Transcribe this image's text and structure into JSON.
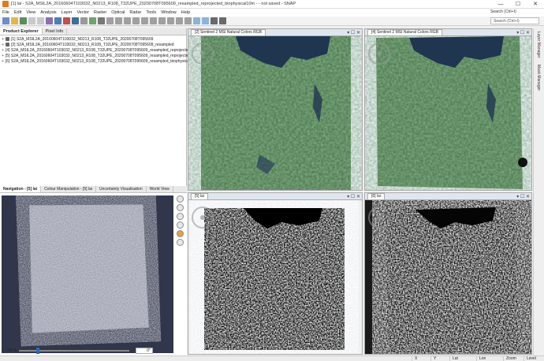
{
  "window": {
    "title": "[1] lai - S2A_MSIL2A_20160604T103032_N0213_R108_T32UPE_20200708T095609_resampled_reprojected_biophysical10m - - not saved - SNAP",
    "controls": {
      "minimize": "—",
      "maximize": "☐",
      "close": "✕"
    }
  },
  "menu": [
    "File",
    "Edit",
    "View",
    "Analysis",
    "Layer",
    "Vector",
    "Raster",
    "Optical",
    "Radar",
    "Tools",
    "Window",
    "Help"
  ],
  "search": {
    "label": "Search (Ctrl+I)",
    "placeholder": "Search (Ctrl+I)"
  },
  "left_tabs": [
    "Product Explorer",
    "Pixel Info"
  ],
  "products": [
    "[1] S2A_MSIL2A_20160604T103032_N0213_R108_T32UPE_20200708T095609",
    "[2] S2A_MSIL2A_20160604T103032_N0213_R108_T32UPE_20200708T095609_resampled",
    "[4] S2A_MSIL2A_20160604T103032_N0213_R108_T32UPE_20200708T095609_resampled_reprojected",
    "[5] S2A_MSIL2A_20160604T103032_N0213_R108_T32UPE_20200708T095609_resampled_reprojected_biophysical",
    "[6] S2A_MSIL2A_20160604T103032_N0213_R108_T32UPE_20200708T095609_resampled_biophysical10m"
  ],
  "nav_tabs": [
    "Navigation - [5] lai",
    "Colour Manipulation - [5] lai",
    "Uncertainty Visualisation",
    "World View"
  ],
  "nav": {
    "scale": "1 : 247.5",
    "angle": "0°"
  },
  "windows": [
    {
      "tab": "[2] Sentinel 2 MSI Natural Colors RGB"
    },
    {
      "tab": "[4] Sentinel 2 MSI Natural Colors RGB"
    },
    {
      "tab": "[5] lai"
    },
    {
      "tab": "[6] lai"
    }
  ],
  "window_controls": "▾ ☐ ✕",
  "right_dock": [
    "Layer Manager",
    "Mask Manager"
  ],
  "status": {
    "x": "X",
    "y": "Y",
    "lat": "Lat",
    "lon": "Lon",
    "zoom": "Zoom",
    "level": "Level"
  },
  "colors": {
    "accent": "#2b6ab7",
    "dark_canvas": "#31364a"
  }
}
